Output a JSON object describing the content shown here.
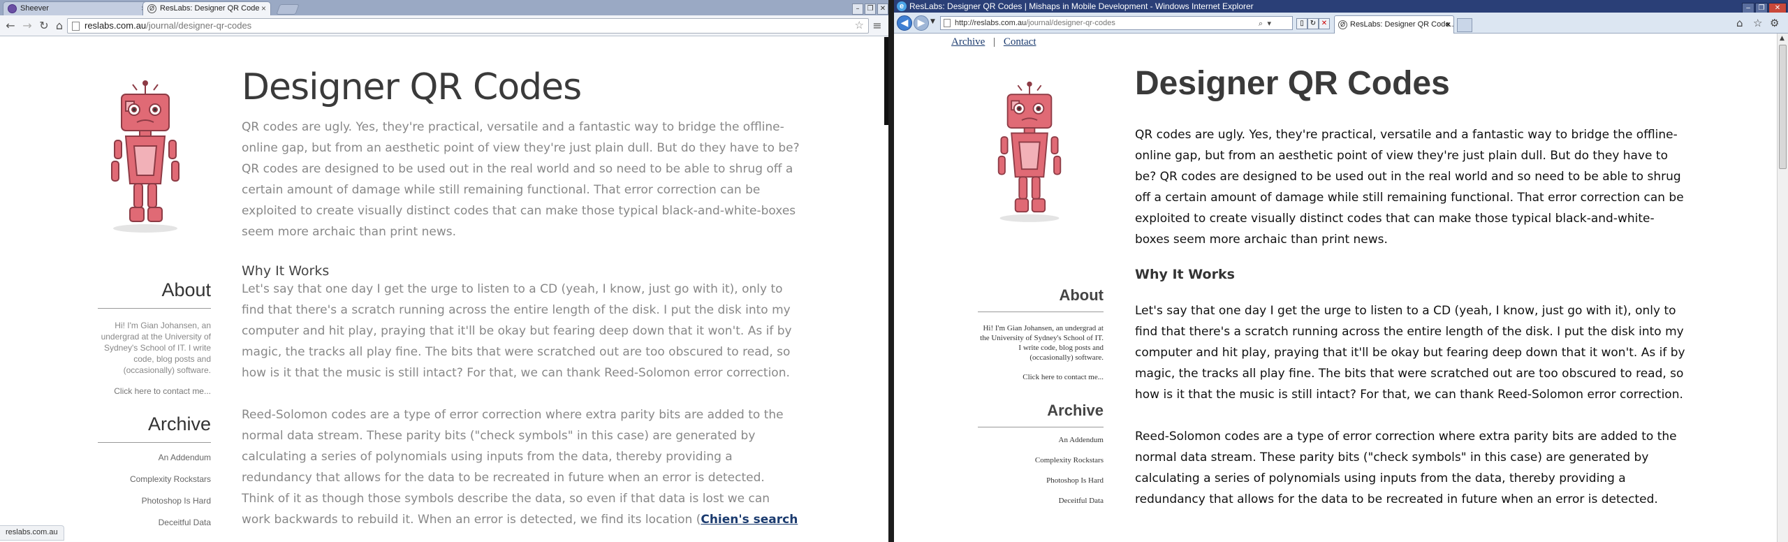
{
  "left_browser": {
    "tabs": [
      {
        "title": "Sheever",
        "active": false
      },
      {
        "title": "ResLabs: Designer QR Code",
        "active": true
      }
    ],
    "url": {
      "domain": "reslabs.com.au",
      "path": "/journal/designer-qr-codes"
    },
    "status_text": "reslabs.com.au"
  },
  "right_browser": {
    "window_title": "ResLabs: Designer QR Codes | Mishaps in Mobile Development - Windows Internet Explorer",
    "url": {
      "domain": "http://reslabs.com.au",
      "path": "/journal/designer-qr-codes"
    },
    "tab_title": "ResLabs: Designer QR Code...",
    "nav": {
      "archive": "Archive",
      "separator": "|",
      "contact": "Contact"
    }
  },
  "article": {
    "title": "Designer QR Codes",
    "p1": "QR codes are ugly. Yes, they're practical, versatile and a fantastic way to bridge the offline-online gap, but from an aesthetic point of view they're just plain dull. But do they have to be? QR codes are designed to be used out in the real world and so need to be able to shrug off a certain amount of damage while still remaining functional. That error correction can be exploited to create visually distinct codes that can make those typical black-and-white-boxes seem more archaic than print news.",
    "h2_why": "Why It Works",
    "p2": "Let's say that one day I get the urge to listen to a CD (yeah, I know, just go with it), only to find that there's a scratch running across the entire length of the disk. I put the disk into my computer and hit play, praying that it'll be okay but fearing deep down that it won't. As if by magic, the tracks all play fine. The bits that were scratched out are too obscured to read, so how is it that the music is still intact? For that, we can thank Reed-Solomon error correction.",
    "p3_left": "Reed-Solomon codes are a type of error correction where extra parity bits are added to the normal data stream. These parity bits (\"check symbols\" in this case) are generated by calculating a series of polynomials using inputs from the data, thereby providing a redundancy that allows for the data to be recreated in future when an error is detected. Think of it as though those symbols describe the data, so even if that data is lost we can work backwards to rebuild it. When an error is detected, we find its location (",
    "p3_left_link": "Chien's search",
    "p3_right": "Reed-Solomon codes are a type of error correction where extra parity bits are added to the normal data stream. These parity bits (\"check symbols\" in this case) are generated by calculating a series of polynomials using inputs from the data, thereby providing a redundancy that allows for the data to be recreated in future when an error is detected."
  },
  "sidebar": {
    "about_heading": "About",
    "about_text": "Hi! I'm Gian Johansen, an undergrad at the University of Sydney's School of IT. I write code, blog posts and (occasionally) software.",
    "contact_link": "Click here to contact me...",
    "archive_heading": "Archive",
    "archive_items": [
      "An Addendum",
      "Complexity Rockstars",
      "Photoshop Is Hard",
      "Deceitful Data"
    ]
  },
  "colors": {
    "robot_body": "#e06a75",
    "robot_dark": "#8d3b45",
    "link": "#1b3b6f",
    "ie_title_bar": "#2a3f77"
  }
}
